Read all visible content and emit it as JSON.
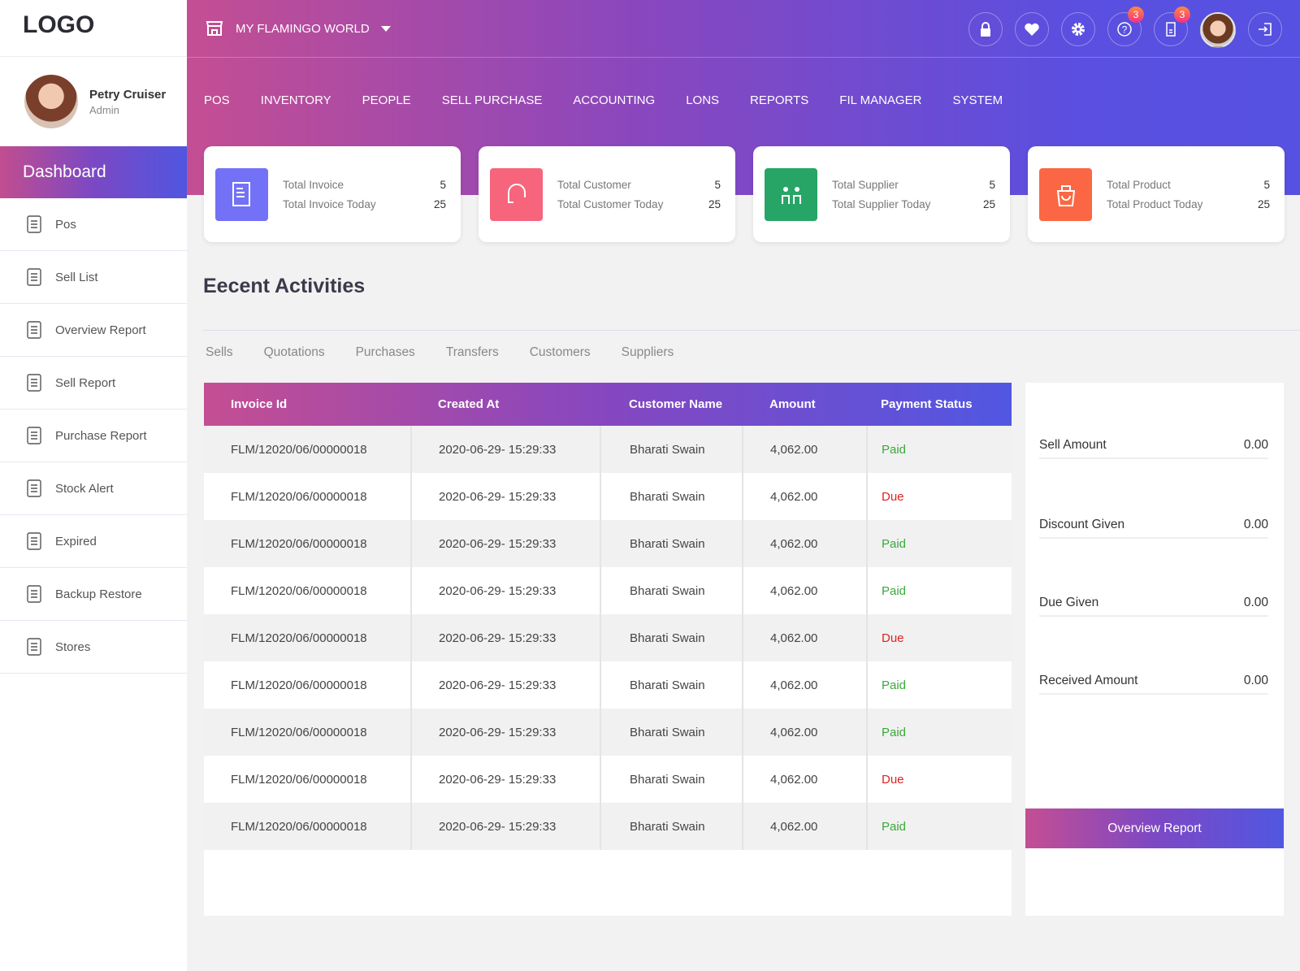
{
  "logo": "LOGO",
  "user": {
    "name": "Petry Cruiser",
    "role": "Admin"
  },
  "sidebar": {
    "active": "Dashboard",
    "items": [
      {
        "label": "Pos",
        "icon": "pos-terminal-icon"
      },
      {
        "label": "Sell List",
        "icon": "clipboard-list-icon"
      },
      {
        "label": "Overview Report",
        "icon": "truck-icon"
      },
      {
        "label": "Sell Report",
        "icon": "report-chart-icon"
      },
      {
        "label": "Purchase Report",
        "icon": "purchase-report-icon"
      },
      {
        "label": "Stock Alert",
        "icon": "warning-icon"
      },
      {
        "label": "Expired",
        "icon": "expired-clock-icon"
      },
      {
        "label": "Backup Restore",
        "icon": "cloud-backup-icon"
      },
      {
        "label": "Stores",
        "icon": "store-icon"
      }
    ]
  },
  "header": {
    "store": "MY FLAMINGO WORLD",
    "badges": {
      "help": "3",
      "invoice": "3"
    },
    "nav": [
      "POS",
      "INVENTORY",
      "PEOPLE",
      "SELL PURCHASE",
      "ACCOUNTING",
      "LONS",
      "REPORTS",
      "FIL MANAGER",
      "SYSTEM"
    ]
  },
  "cards": [
    {
      "label1": "Total Invoice",
      "value1": "5",
      "label2": "Total Invoice Today",
      "value2": "25",
      "color": "#7371f6"
    },
    {
      "label1": "Total Customer",
      "value1": "5",
      "label2": "Total Customer Today",
      "value2": "25",
      "color": "#f7657d"
    },
    {
      "label1": "Total Supplier",
      "value1": "5",
      "label2": "Total Supplier Today",
      "value2": "25",
      "color": "#27a566"
    },
    {
      "label1": "Total Product",
      "value1": "5",
      "label2": "Total Product Today",
      "value2": "25",
      "color": "#fb6744"
    }
  ],
  "activities": {
    "title": "Eecent Activities",
    "tabs": [
      "Sells",
      "Quotations",
      "Purchases",
      "Transfers",
      "Customers",
      "Suppliers"
    ]
  },
  "table": {
    "columns": [
      "Invoice Id",
      "Created At",
      "Customer Name",
      "Amount",
      "Payment Status"
    ],
    "rows": [
      [
        "FLM/12020/06/00000018",
        "2020-06-29- 15:29:33",
        "Bharati Swain",
        "4,062.00",
        "Paid"
      ],
      [
        "FLM/12020/06/00000018",
        "2020-06-29- 15:29:33",
        "Bharati Swain",
        "4,062.00",
        "Due"
      ],
      [
        "FLM/12020/06/00000018",
        "2020-06-29- 15:29:33",
        "Bharati Swain",
        "4,062.00",
        "Paid"
      ],
      [
        "FLM/12020/06/00000018",
        "2020-06-29- 15:29:33",
        "Bharati Swain",
        "4,062.00",
        "Paid"
      ],
      [
        "FLM/12020/06/00000018",
        "2020-06-29- 15:29:33",
        "Bharati Swain",
        "4,062.00",
        "Due"
      ],
      [
        "FLM/12020/06/00000018",
        "2020-06-29- 15:29:33",
        "Bharati Swain",
        "4,062.00",
        "Paid"
      ],
      [
        "FLM/12020/06/00000018",
        "2020-06-29- 15:29:33",
        "Bharati Swain",
        "4,062.00",
        "Paid"
      ],
      [
        "FLM/12020/06/00000018",
        "2020-06-29- 15:29:33",
        "Bharati Swain",
        "4,062.00",
        "Due"
      ],
      [
        "FLM/12020/06/00000018",
        "2020-06-29- 15:29:33",
        "Bharati Swain",
        "4,062.00",
        "Paid"
      ]
    ]
  },
  "summary": {
    "items": [
      {
        "label": "Sell Amount",
        "value": "0.00"
      },
      {
        "label": "Discount Given",
        "value": "0.00"
      },
      {
        "label": "Due Given",
        "value": "0.00"
      },
      {
        "label": "Received Amount",
        "value": "0.00"
      }
    ],
    "button": "Overview Report"
  },
  "colors": {
    "paid": "#3aa83a",
    "due": "#e02020",
    "gradient_start": "#c44e93",
    "gradient_end": "#5157e2"
  }
}
